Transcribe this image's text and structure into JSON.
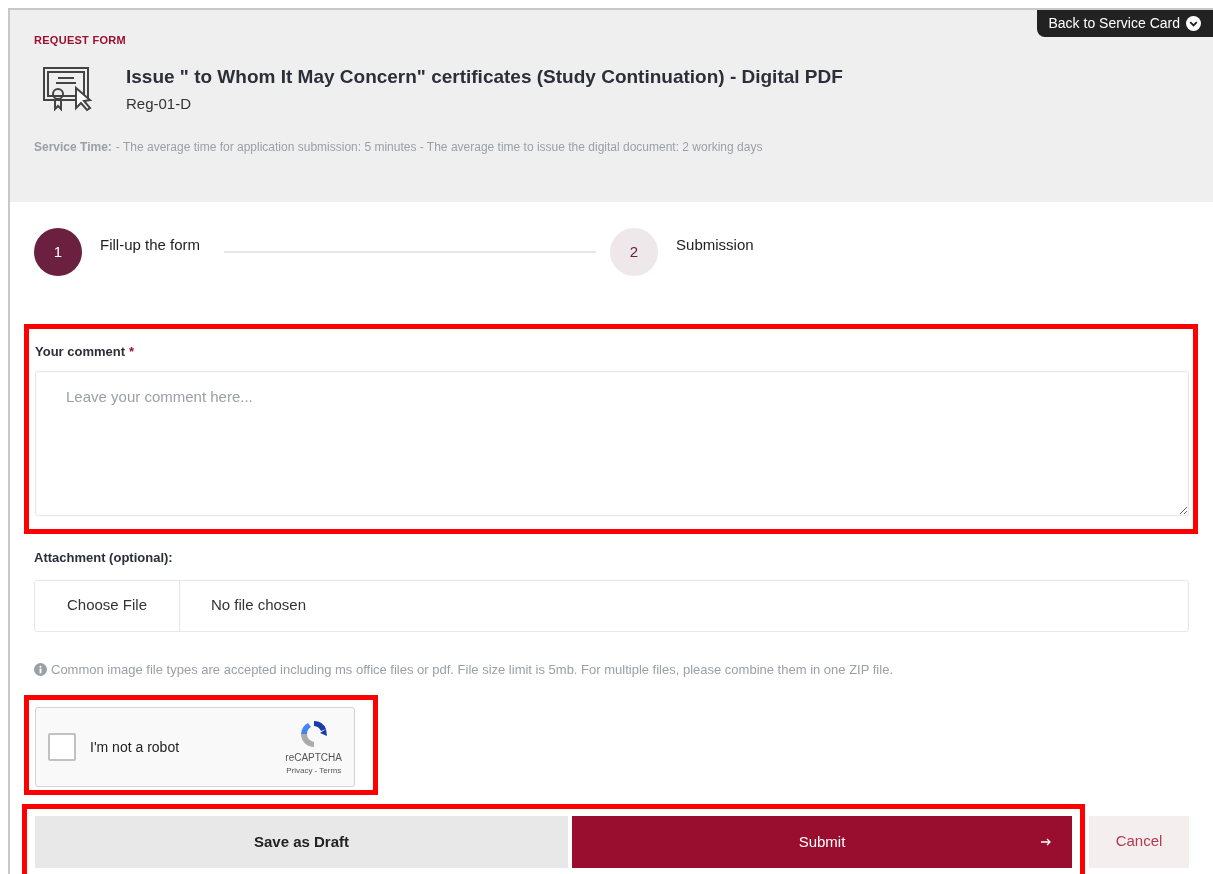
{
  "header": {
    "eyebrow": "REQUEST FORM",
    "title": "Issue \" to Whom It May Concern\" certificates (Study Continuation) - Digital PDF",
    "code": "Reg-01-D",
    "service_time_label": "Service Time:",
    "service_time": "- The average time for application submission: 5 minutes - The average time to issue the digital document: 2 working days",
    "back_button": "Back to Service Card"
  },
  "steps": [
    {
      "number": "1",
      "label": "Fill-up the form",
      "selected": true
    },
    {
      "number": "2",
      "label": "Submission",
      "selected": false
    }
  ],
  "comment": {
    "label": "Your comment",
    "required_mark": "*",
    "placeholder": "Leave your comment here..."
  },
  "attachment": {
    "label": "Attachment (optional):",
    "button": "Choose File",
    "status": "No file chosen",
    "hint": "Common image file types are accepted including ms office files or pdf. File size limit is 5mb. For multiple files, please combine them in one ZIP file."
  },
  "captcha": {
    "label": "I'm not a robot",
    "checked": false,
    "brand": "reCAPTCHA",
    "links": "Privacy - Terms"
  },
  "buttons": {
    "draft": "Save as Draft",
    "submit": "Submit",
    "cancel": "Cancel"
  }
}
